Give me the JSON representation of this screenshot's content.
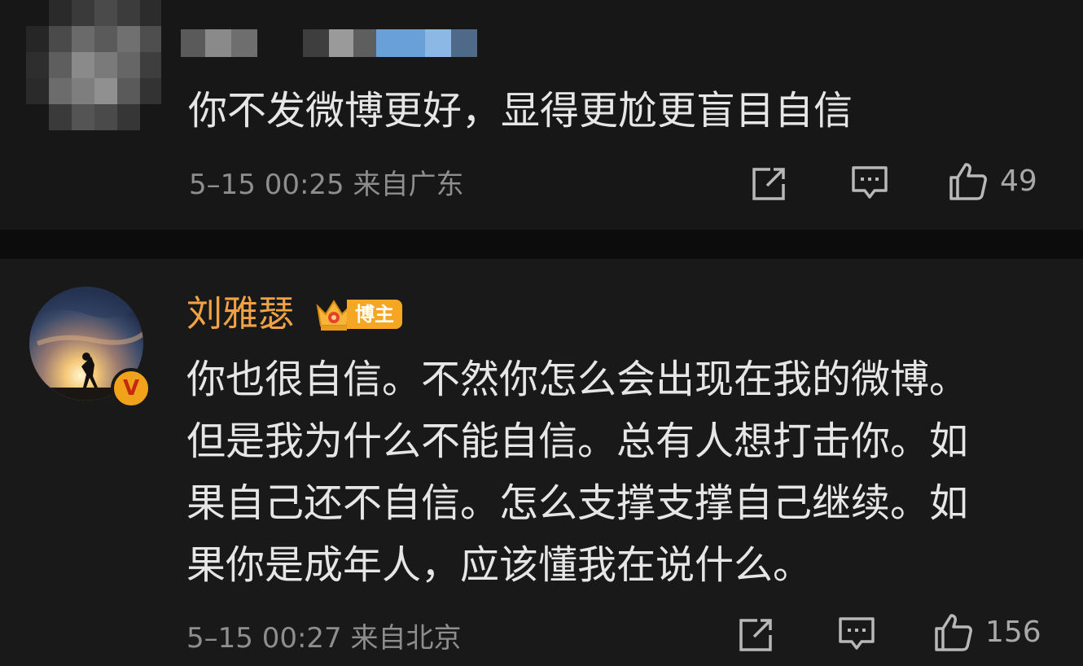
{
  "comment1": {
    "text": "你不发微博更好，显得更尬更盲目自信",
    "time_location": "5–15 00:25 来自广东",
    "like_count": "49",
    "icons": [
      "share-icon",
      "comment-icon",
      "like-icon"
    ]
  },
  "comment2": {
    "author": "刘雅瑟",
    "badge": "博主",
    "lines": [
      "你也很自信。不然你怎么会出现在我的微博。",
      "但是我为什么不能自信。总有人想打击你。如",
      "果自己还不自信。怎么支撑支撑自己继续。如",
      "果你是成年人，应该懂我在说什么。"
    ],
    "time_location": "5–15 00:27 来自北京",
    "like_count": "156",
    "verified_badge": "V",
    "icons": [
      "avatar",
      "verified-badge-icon",
      "crown-icon",
      "share-icon",
      "comment-icon",
      "like-icon"
    ]
  },
  "colors": {
    "background": "#171717",
    "divider": "#0c0c0c",
    "author_name": "#f0a245",
    "host_badge": "#f5a623",
    "text": "#e6e6e6",
    "meta": "#8e8e8e"
  }
}
